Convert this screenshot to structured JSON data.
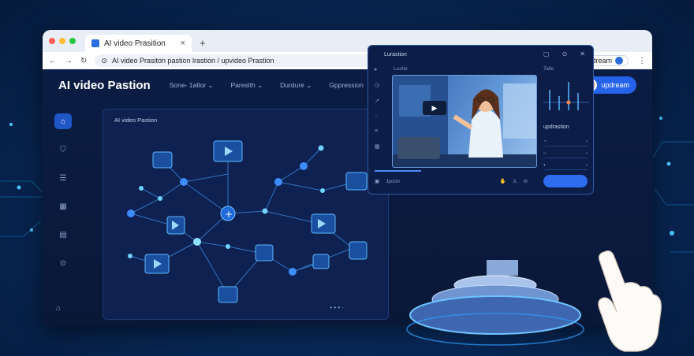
{
  "colors": {
    "accent": "#2563eb",
    "node": "#53b8ff",
    "bg": "#051a3c"
  },
  "browser": {
    "tab_title": "AI video Prasition",
    "new_tab": "+",
    "address": "AI video Prasiton pastion lrastion / upvideo Prastion",
    "profile_label": "updream",
    "icons": [
      "back-icon",
      "forward-icon",
      "reload-icon",
      "mic-icon",
      "star-icon",
      "bookmark-icon",
      "home-icon",
      "download-icon",
      "menu-icon"
    ]
  },
  "header": {
    "logo": "AI video Pastion",
    "nav": [
      {
        "label": "Sone- 1atlor"
      },
      {
        "label": "Paresith"
      },
      {
        "label": "Durdure"
      },
      {
        "label": "Gppression"
      }
    ],
    "user_label": "updream"
  },
  "sidebar": {
    "items": [
      "home-icon",
      "shield-icon",
      "list-icon",
      "calendar-icon",
      "table-icon",
      "circle-arrow-icon"
    ],
    "bottom": "settings-icon"
  },
  "canvas": {
    "title": "AI video Pastion",
    "controls": "‹ ›  ·",
    "footer": "• • •  ·"
  },
  "panel": {
    "title": "Lurastion",
    "sub_left": "Lushe",
    "sub_right": "Talle",
    "update_label": "updrastion",
    "footer_label": "Jpoon",
    "progress": 0.22
  }
}
